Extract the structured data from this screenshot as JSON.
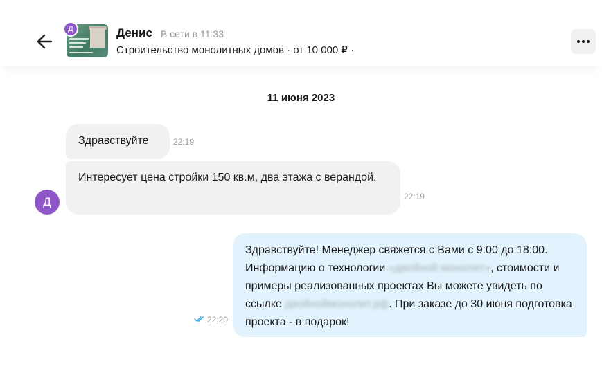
{
  "header": {
    "contact_name": "Денис",
    "status": "В сети в 11:33",
    "listing": "Строительство монолитных домов · от 10 000 ₽ ·",
    "avatar_letter": "Д",
    "thumbnail_icon": "listing-thumbnail",
    "back_icon": "arrow-left-icon",
    "more_icon": "more-dots-icon"
  },
  "date_separator": "11 июня 2023",
  "incoming": {
    "avatar_letter": "Д",
    "messages": [
      {
        "text": "Здравствуйте",
        "time": "22:19"
      },
      {
        "text": "Интересует цена стройки 150 кв.м, два этажа с верандой.",
        "time": "22:19"
      }
    ]
  },
  "outgoing": {
    "part1": "Здравствуйте! Менеджер свяжется с Вами с 9:00 до 18:00. Информацию о технологии ",
    "blur1": "«двойной монолит»",
    "part2": ", стоимости и примеры реализованных проектах Вы можете увидеть по ссылке ",
    "blur2": "двойноймонолит.рф",
    "part3": ". При заказе до 30 июня подготовка проекта - в подарок!",
    "time": "22:20",
    "read_icon": "double-check-icon",
    "colors": {
      "bubble": "#e2f3fd",
      "check": "#2aa7e6"
    }
  },
  "colors": {
    "avatar": "#8e56c9",
    "incoming_bubble": "#f2f1ef"
  }
}
